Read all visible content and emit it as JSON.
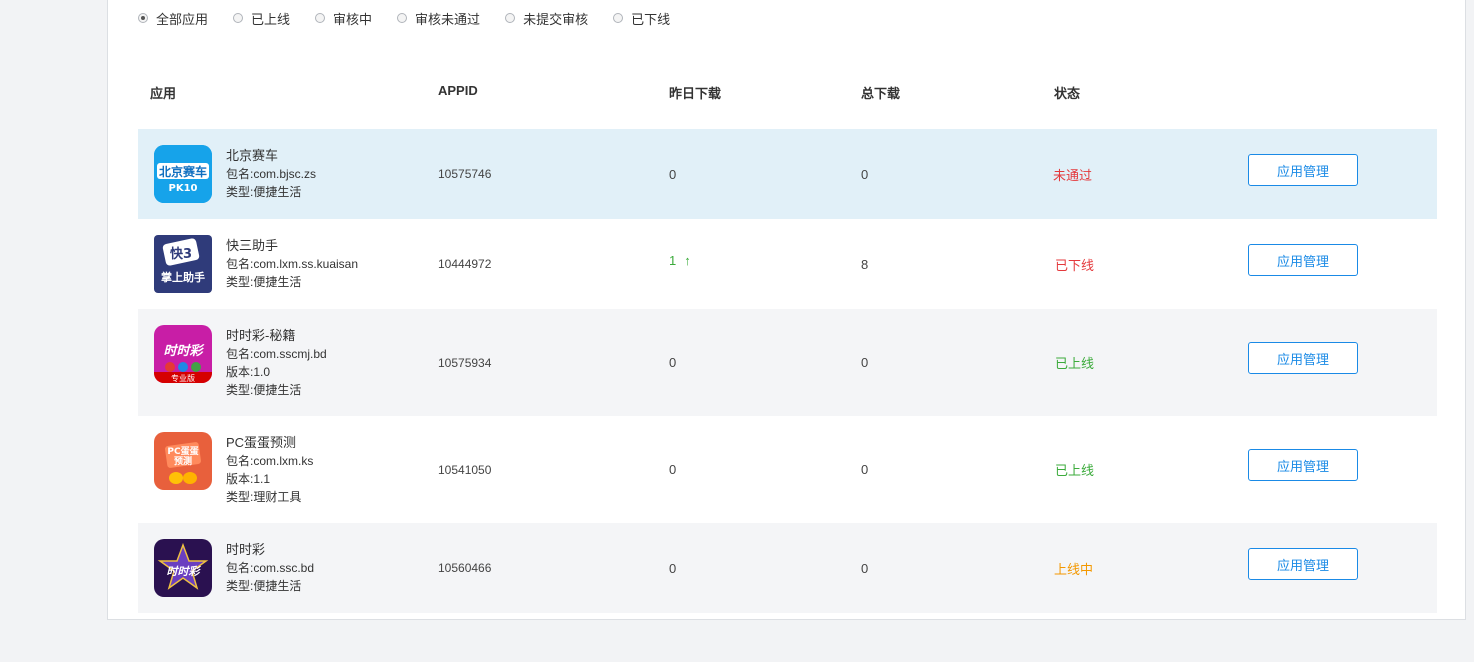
{
  "filters": [
    {
      "label": "全部应用",
      "checked": true
    },
    {
      "label": "已上线",
      "checked": false
    },
    {
      "label": "审核中",
      "checked": false
    },
    {
      "label": "审核未通过",
      "checked": false
    },
    {
      "label": "未提交审核",
      "checked": false
    },
    {
      "label": "已下线",
      "checked": false
    }
  ],
  "table": {
    "headers": {
      "app": "应用",
      "appid": "APPID",
      "yesterday": "昨日下载",
      "total": "总下载",
      "status": "状态"
    },
    "rows": [
      {
        "name": "北京赛车",
        "pkg": "包名:com.bjsc.zs",
        "version": "",
        "type": "类型:便捷生活",
        "appid": "10575746",
        "yesterday": "0",
        "yesterday_arrow": "",
        "total": "0",
        "status": "未通过",
        "status_color": "#e4393c",
        "button": "应用管理",
        "icon_text": "北京赛车",
        "icon_sub": "PK10"
      },
      {
        "name": "快三助手",
        "pkg": "包名:com.lxm.ss.kuaisan",
        "version": "",
        "type": "类型:便捷生活",
        "appid": "10444972",
        "yesterday": "1",
        "yesterday_arrow": "↑",
        "total": "8",
        "status": "已下线",
        "status_color": "#e4393c",
        "button": "应用管理",
        "icon_text": "快3",
        "icon_sub": "掌上助手"
      },
      {
        "name": "时时彩-秘籍",
        "pkg": "包名:com.sscmj.bd",
        "version": "版本:1.0",
        "type": "类型:便捷生活",
        "appid": "10575934",
        "yesterday": "0",
        "yesterday_arrow": "",
        "total": "0",
        "status": "已上线",
        "status_color": "#3bab3b",
        "button": "应用管理",
        "icon_text": "时时彩",
        "icon_sub": "专业版"
      },
      {
        "name": "PC蛋蛋预测",
        "pkg": "包名:com.lxm.ks",
        "version": "版本:1.1",
        "type": "类型:理财工具",
        "appid": "10541050",
        "yesterday": "0",
        "yesterday_arrow": "",
        "total": "0",
        "status": "已上线",
        "status_color": "#3bab3b",
        "button": "应用管理",
        "icon_text": "PC蛋蛋",
        "icon_sub": "预测"
      },
      {
        "name": "时时彩",
        "pkg": "包名:com.ssc.bd",
        "version": "",
        "type": "类型:便捷生活",
        "appid": "10560466",
        "yesterday": "0",
        "yesterday_arrow": "",
        "total": "0",
        "status": "上线中",
        "status_color": "#f39800",
        "button": "应用管理",
        "icon_text": "时时彩",
        "icon_sub": ""
      }
    ]
  },
  "colors": {
    "accent": "#1a8ae6",
    "row_highlight": "#e1f0f8",
    "row_alt": "#f4f5f7"
  }
}
